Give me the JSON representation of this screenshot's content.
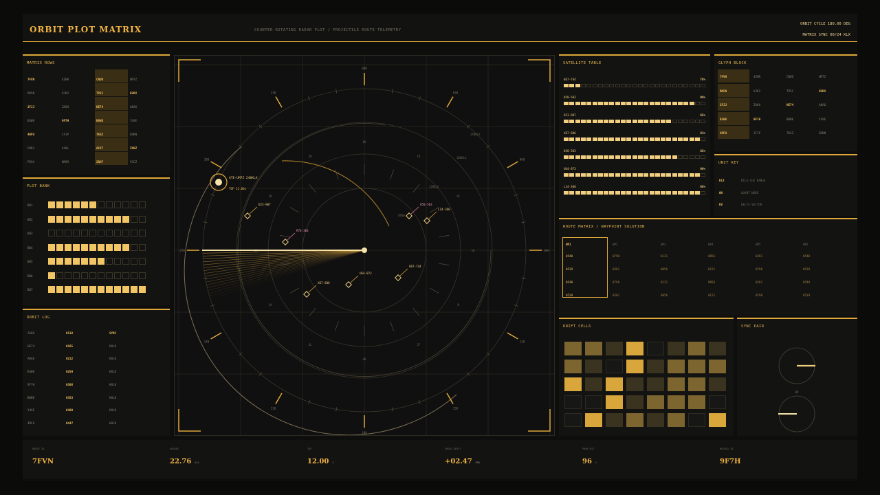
{
  "header": {
    "title": "ORBIT PLOT MATRIX",
    "subtitle": "COUNTER-ROTATING RADAR PLOT / PROJECTILE ROUTE TELEMETRY",
    "orbit_cycle": "ORBIT CYCLE 180.00 DEG",
    "matrix_sync": "MATRIX SYNC 00/24 KLX"
  },
  "matrix_rows": {
    "title": "MATRIX ROWS",
    "rows": [
      [
        "7FVN",
        "4ZHR",
        "CNUD",
        "UM7Z"
      ],
      [
        "MA5N",
        "VJK2",
        "TPSC",
        "U2KX"
      ],
      [
        "2FJJ",
        "ZA6H",
        "HE74",
        "A8A6"
      ],
      [
        "B3W6",
        "9F7H",
        "B0NE",
        "Y4XE"
      ],
      [
        "4RFU",
        "1F1P",
        "7KGZ",
        "EDKN"
      ],
      [
        "PUD3",
        "A40L",
        "AFX7",
        "ZXHZ"
      ],
      [
        "P83A",
        "6M69",
        "2RH7",
        "V3CZ"
      ]
    ]
  },
  "plot_bank": {
    "title": "PLOT BANK",
    "rows": [
      {
        "label": "B01",
        "filled": 6
      },
      {
        "label": "B02",
        "filled": 10
      },
      {
        "label": "B03",
        "filled": 0
      },
      {
        "label": "B04",
        "filled": 10
      },
      {
        "label": "B05",
        "filled": 7
      },
      {
        "label": "B06",
        "filled": 1
      },
      {
        "label": "B07",
        "filled": 12
      }
    ]
  },
  "orbit_log": {
    "title": "ORBIT LOG",
    "rows": [
      [
        "ZA6H",
        "0118",
        "SYNC"
      ],
      [
        "HE74",
        "0165",
        "HOLD"
      ],
      [
        "A8A6",
        "0212",
        "HOLD"
      ],
      [
        "B3W6",
        "0259",
        "HOLD"
      ],
      [
        "9F7H",
        "0306",
        "HOLD"
      ],
      [
        "B0NE",
        "0353",
        "HOLD"
      ],
      [
        "Y4XE",
        "0400",
        "HOLD"
      ],
      [
        "4RFU",
        "0447",
        "HOLD"
      ]
    ]
  },
  "radar": {
    "deg_labels": [
      "000",
      "030",
      "060",
      "090",
      "120",
      "150",
      "180",
      "210",
      "240",
      "270",
      "300",
      "330"
    ],
    "inner_labels": [
      "0V",
      "FU",
      "AF",
      "1K",
      "M",
      "2F",
      "AH",
      "4L",
      "SA",
      "0R",
      "3K",
      "ZH"
    ],
    "markers": [
      {
        "id": "867-744"
      },
      {
        "id": "U64-873"
      },
      {
        "id": "X67-606"
      },
      {
        "id": "D23-907"
      },
      {
        "id": "R76-303"
      },
      {
        "id": "850-503"
      },
      {
        "id": "L14-360"
      }
    ],
    "target_label": "ATE-UM7Z 240KLX",
    "tof_label": "TOF 12.00s",
    "range_label_1": "240KLX",
    "range_label_2": "180KLX",
    "range_label_3": "120KLX",
    "sweep_label": "0T00"
  },
  "satellite_table": {
    "title": "SATELLITE TABLE",
    "rows": [
      {
        "id": "867-744",
        "pct": "78%",
        "filled": 3
      },
      {
        "id": "850-503",
        "pct": "96%",
        "filled": 23
      },
      {
        "id": "D23-907",
        "pct": "65%",
        "filled": 19
      },
      {
        "id": "X67-606",
        "pct": "81%",
        "filled": 24
      },
      {
        "id": "850-503",
        "pct": "82%",
        "filled": 20
      },
      {
        "id": "U64-873",
        "pct": "96%",
        "filled": 24
      },
      {
        "id": "L14-360",
        "pct": "88%",
        "filled": 24
      }
    ]
  },
  "glyph_block": {
    "title": "GLYPH BLOCK",
    "rows": [
      [
        "7FVN",
        "4ZHR",
        "CNUD",
        "UM7Z"
      ],
      [
        "MA5N",
        "VJK2",
        "TPSC",
        "U2KX"
      ],
      [
        "2FJJ",
        "ZA6H",
        "HE74",
        "A8A6"
      ],
      [
        "B3W6",
        "9F7H",
        "B0NE",
        "Y4XE"
      ],
      [
        "4RFU",
        "1F1P",
        "7KGZ",
        "EDKN"
      ]
    ]
  },
  "unit_key": {
    "title": "UNIT KEY",
    "rows": [
      [
        "KLX",
        "KILO-LUX RANGE"
      ],
      [
        "QN",
        "QUANT NODE"
      ],
      [
        "DV",
        "DELTA VECTOR"
      ]
    ]
  },
  "route_matrix": {
    "title": "ROUTE MATRIX / WAYPOINT SOLUTION",
    "headers": [
      "WP1",
      "WP2",
      "WP3",
      "WP4",
      "WP5",
      "WP6"
    ],
    "rows": [
      [
        "0540",
        "0798",
        "0121",
        "0856",
        "0281",
        "0540"
      ],
      [
        "0539",
        "0281",
        "0856",
        "0121",
        "0798",
        "0539"
      ],
      [
        "0540",
        "0798",
        "0121",
        "0856",
        "0281",
        "0540"
      ],
      [
        "0539",
        "0281",
        "0856",
        "0121",
        "0798",
        "0539"
      ]
    ]
  },
  "drift_cells": {
    "title": "DRIFT CELLS",
    "levels": [
      [
        2,
        2,
        1,
        3,
        0,
        1,
        2,
        1
      ],
      [
        2,
        1,
        0,
        3,
        1,
        2,
        2,
        2
      ],
      [
        3,
        1,
        3,
        1,
        1,
        2,
        2,
        1
      ],
      [
        0,
        0,
        3,
        1,
        2,
        2,
        2,
        0
      ],
      [
        0,
        3,
        1,
        2,
        1,
        2,
        0,
        3
      ]
    ]
  },
  "sync_pair": {
    "title": "SYNC PAIR",
    "mid_label": "0V"
  },
  "footer": {
    "fields": [
      {
        "label": "ROUTE ID",
        "value": "7FVN",
        "unit": ""
      },
      {
        "label": "APOGEE",
        "value": "22.76",
        "unit": "KLX"
      },
      {
        "label": "TOF",
        "value": "12.00",
        "unit": "S"
      },
      {
        "label": "CROSS DRIFT",
        "value": "+02.47",
        "unit": "MRD"
      },
      {
        "label": "PROB HIT",
        "value": "96",
        "unit": "%"
      },
      {
        "label": "MATRIX ID",
        "value": "9F7H",
        "unit": ""
      }
    ]
  }
}
